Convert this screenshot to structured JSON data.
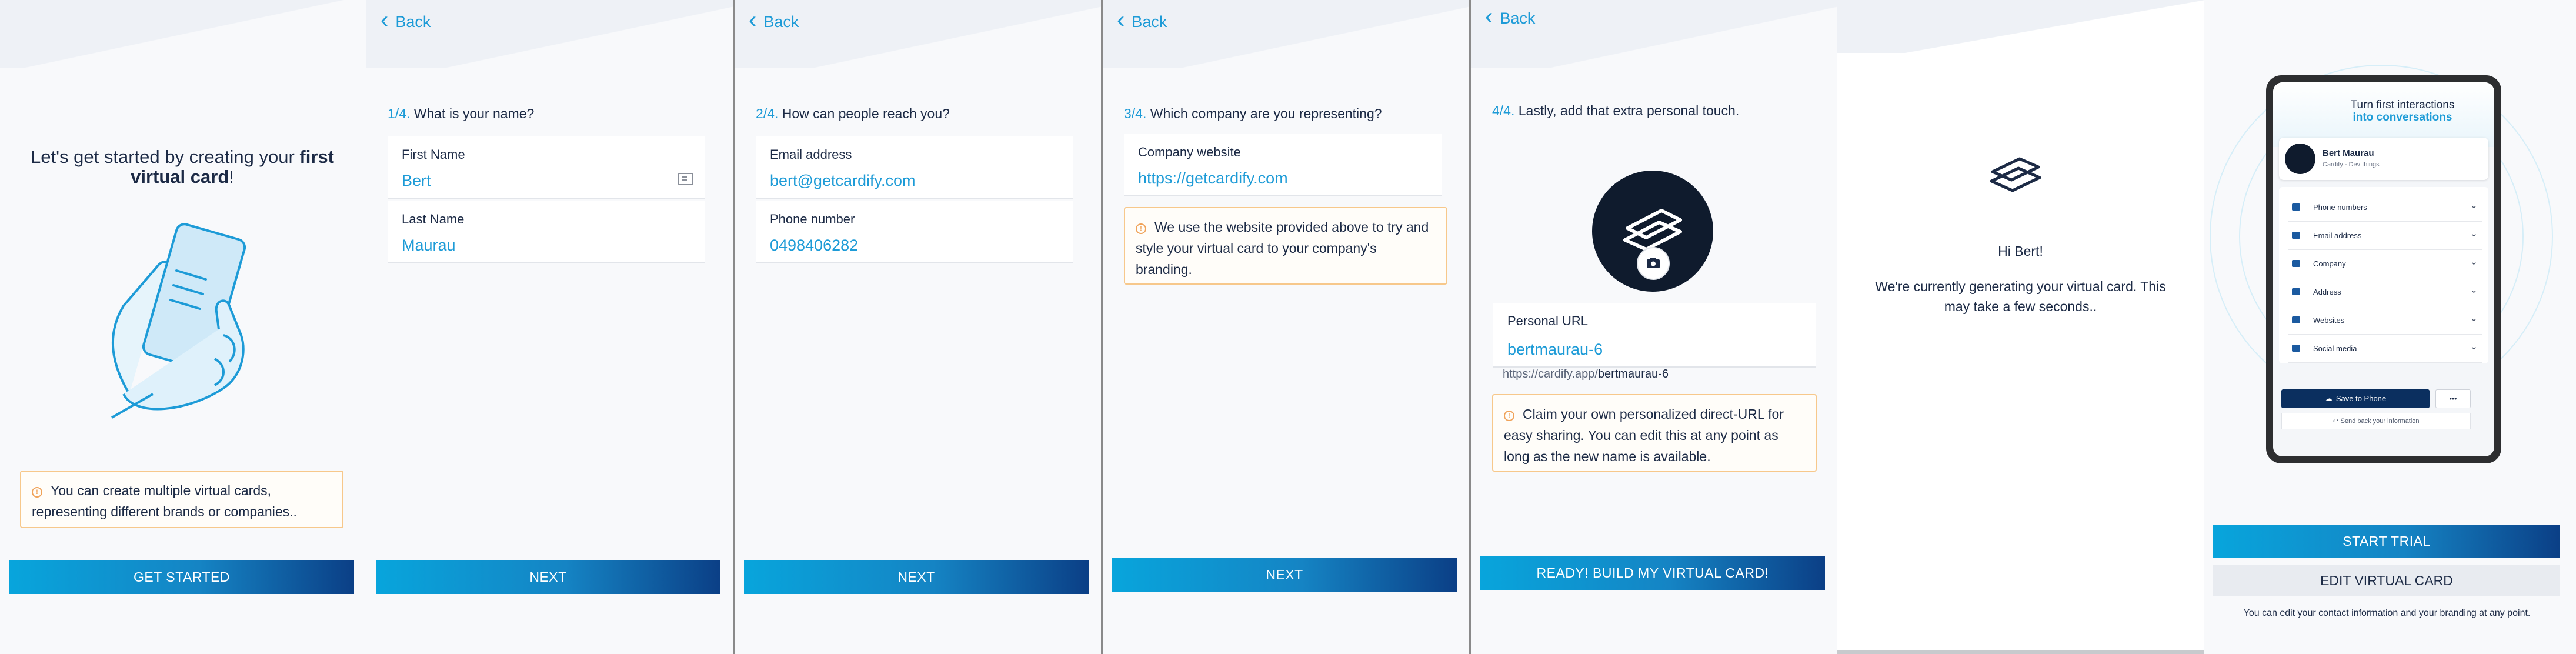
{
  "colors": {
    "accent": "#1d9bd7",
    "dark_blue": "#0b3f86",
    "warning_border": "#f7c88b",
    "text": "#1c2a45"
  },
  "back_label": "Back",
  "screen1": {
    "heading_pre": "Let's get started by creating your ",
    "heading_bold": "first virtual card",
    "heading_post": "!",
    "notice": "You can create multiple virtual cards, representing different brands or companies..",
    "button": "GET STARTED"
  },
  "screen2": {
    "step_num": "1/4.",
    "step_text": "What is your name?",
    "first_name_label": "First Name",
    "first_name_value": "Bert",
    "last_name_label": "Last Name",
    "last_name_value": "Maurau",
    "button": "NEXT"
  },
  "screen3": {
    "step_num": "2/4.",
    "step_text": "How can people reach you?",
    "email_label": "Email address",
    "email_value": "bert@getcardify.com",
    "phone_label": "Phone number",
    "phone_value": "0498406282",
    "button": "NEXT"
  },
  "screen4": {
    "step_num": "3/4.",
    "step_text": "Which company are you representing?",
    "website_label": "Company website",
    "website_value": "https://getcardify.com",
    "notice": "We use the website provided above to try and style your virtual card to your company's branding.",
    "button": "NEXT"
  },
  "screen5": {
    "step_num": "4/4.",
    "step_text": "Lastly, add that extra personal touch.",
    "url_label": "Personal URL",
    "url_value": "bertmaurau-6",
    "url_prefix": "https://cardify.app/",
    "url_slug": "bertmaurau-6",
    "notice": "Claim your own personalized direct-URL for easy sharing. You can edit this at any point as long as the new name is available.",
    "button": "READY! BUILD MY VIRTUAL CARD!"
  },
  "screen6": {
    "greeting": "Hi Bert!",
    "message": "We're currently generating your virtual card. This may take a few seconds.."
  },
  "screen7": {
    "banner_line1": "Turn first interactions",
    "banner_line2": "into conversations",
    "card_name": "Bert Maurau",
    "card_sub": "Cardify - Dev things",
    "rows": [
      {
        "label": "Phone numbers",
        "icon": "phone-icon"
      },
      {
        "label": "Email address",
        "icon": "mail-icon"
      },
      {
        "label": "Company",
        "icon": "laptop-icon"
      },
      {
        "label": "Address",
        "icon": "pin-icon"
      },
      {
        "label": "Websites",
        "icon": "globe-icon"
      },
      {
        "label": "Social media",
        "icon": "link-icon"
      }
    ],
    "save_button": "Save to Phone",
    "more_button": "•••",
    "send_back": "Send back your information",
    "start_trial": "START TRIAL",
    "edit_card": "EDIT VIRTUAL CARD",
    "footer_note": "You can edit your contact information and your branding at any point."
  }
}
